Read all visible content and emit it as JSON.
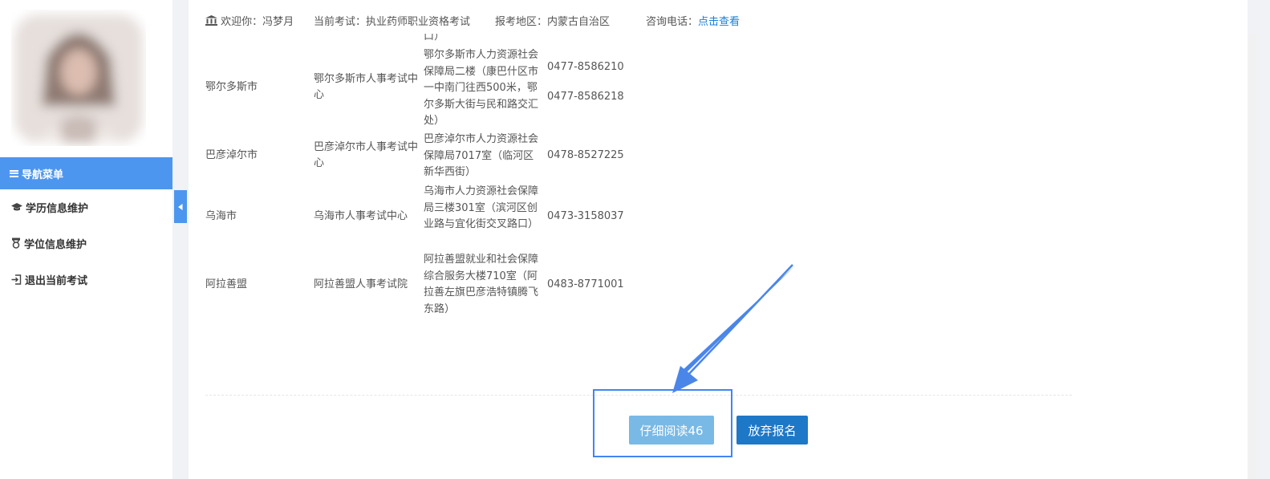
{
  "sidebar": {
    "nav_title": "导航菜单",
    "items": [
      {
        "label": "学历信息维护",
        "icon": "graduation-cap-icon"
      },
      {
        "label": "学位信息维护",
        "icon": "medal-icon"
      },
      {
        "label": "退出当前考试",
        "icon": "logout-icon"
      }
    ]
  },
  "header": {
    "welcome": "欢迎你：冯梦月",
    "exam": "当前考试：执业药师职业资格考试",
    "region": "报考地区：内蒙古自治区",
    "phone_label": "咨询电话：",
    "phone_link": "点击查看"
  },
  "table": {
    "top_fragment": "口）",
    "rows": [
      {
        "city": "鄂尔多斯市",
        "org": "鄂尔多斯市人事考试中心",
        "address": "鄂尔多斯市人力资源社会保障局二楼（康巴什区市一中南门往西500米，鄂尔多斯大街与民和路交汇处）",
        "phones": [
          "0477-8586210",
          "0477-8586218"
        ]
      },
      {
        "city": "巴彦淖尔市",
        "org": "巴彦淖尔市人事考试中心",
        "address": "巴彦淖尔市人力资源社会保障局7017室（临河区新华西街）",
        "phones": [
          "0478-8527225"
        ]
      },
      {
        "city": "乌海市",
        "org": "乌海市人事考试中心",
        "address": "乌海市人力资源社会保障局三楼301室（滨河区创业路与宜化街交叉路口）",
        "phones": [
          "0473-3158037"
        ]
      },
      {
        "city": "阿拉善盟",
        "org": "阿拉善盟人事考试院",
        "address": "阿拉善盟就业和社会保障综合服务大楼710室（阿拉善左旗巴彦浩特镇腾飞东路）",
        "phones": [
          "0483-8771001"
        ]
      }
    ]
  },
  "buttons": {
    "read": "仔细阅读46",
    "quit": "放弃报名"
  },
  "colors": {
    "accent": "#4d96ef",
    "link": "#1a7fd6",
    "read_button": "#78b9e6",
    "quit_button": "#1e78c8",
    "annotation": "#4285f4"
  }
}
